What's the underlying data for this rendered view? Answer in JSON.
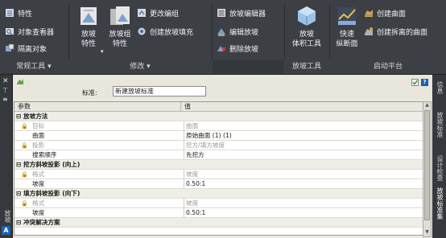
{
  "ribbon": {
    "common_tools": {
      "title": "常规工具",
      "buttons": [
        "特性",
        "对象查看器",
        "隔离对象"
      ]
    },
    "modify": {
      "title": "修改",
      "grading_properties": "放坡\n特性",
      "grading_group_properties": "放坡组\n特性",
      "small_buttons": [
        "更改编组",
        "创建放坡填充"
      ]
    },
    "editing": {
      "buttons": [
        "放坡编辑器",
        "编辑放坡",
        "删除放坡"
      ]
    },
    "grading_tools": {
      "title": "放坡工具",
      "button": "放坡\n体积工具"
    },
    "launch_pad": {
      "title": "启动平台",
      "quick_profile": "快速\n纵断面",
      "buttons": [
        "创建曲面",
        "创建拆离的曲面"
      ]
    }
  },
  "palette": {
    "left_tab": "放坡",
    "right_tabs": [
      "信息",
      "放坡标准",
      "设计检查",
      "放坡标准集"
    ],
    "name_label": "标准:",
    "name_value": "新建放坡标准",
    "help": "?",
    "grid": {
      "headers": [
        "参数",
        "值"
      ],
      "rows": [
        {
          "type": "group",
          "label": "放坡方法",
          "value": ""
        },
        {
          "type": "item",
          "locked": true,
          "disabled": true,
          "label": "目标",
          "value": "曲面"
        },
        {
          "type": "item",
          "locked": false,
          "disabled": false,
          "label": "曲面",
          "value": "原始曲面 (1) (1)"
        },
        {
          "type": "item",
          "locked": true,
          "disabled": true,
          "label": "投影",
          "value": "挖方/填方坡度"
        },
        {
          "type": "item",
          "locked": false,
          "disabled": false,
          "label": "搜索顺序",
          "value": "先挖方"
        },
        {
          "type": "group",
          "label": "挖方斜坡投影 (向上)",
          "value": ""
        },
        {
          "type": "item",
          "locked": true,
          "disabled": true,
          "label": "格式",
          "value": "坡度"
        },
        {
          "type": "item",
          "locked": false,
          "disabled": false,
          "label": "坡度",
          "value": "0.50:1"
        },
        {
          "type": "group",
          "label": "填方斜坡投影 (向下)",
          "value": ""
        },
        {
          "type": "item",
          "locked": true,
          "disabled": true,
          "label": "格式",
          "value": "坡度"
        },
        {
          "type": "item",
          "locked": false,
          "disabled": false,
          "label": "坡度",
          "value": "0.50:1"
        },
        {
          "type": "group",
          "label": "冲突解决方案",
          "value": ""
        }
      ]
    }
  }
}
